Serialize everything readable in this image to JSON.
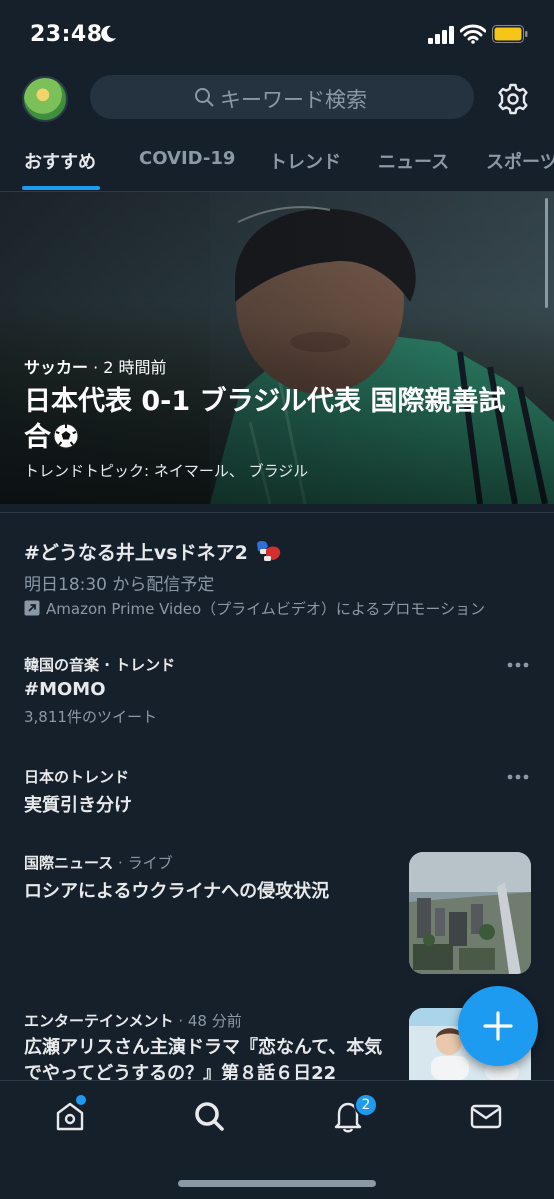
{
  "status_bar": {
    "time": "23:48"
  },
  "search": {
    "placeholder": "キーワード検索"
  },
  "tabs": [
    {
      "label": "おすすめ"
    },
    {
      "label": "COVID-19"
    },
    {
      "label": "トレンド"
    },
    {
      "label": "ニュース"
    },
    {
      "label": "スポーツ"
    }
  ],
  "hero": {
    "category": "サッカー",
    "time": "· 2 時間前",
    "title": "日本代表 0-1 ブラジル代表 国際親善試合",
    "emoji": "soccer-ball-icon",
    "topics": "トレンドトピック: ネイマール、 ブラジル"
  },
  "promo": {
    "title": "#どうなる井上vsドネア2",
    "emoji": "boxing-glove-icon",
    "subtitle": "明日18:30 から配信予定",
    "ad_text": "Amazon Prime Video（プライムビデオ）によるプロモーション"
  },
  "trends": [
    {
      "context": "韓国の音楽 · トレンド",
      "title": "#MOMO",
      "count": "3,811件のツイート"
    },
    {
      "context": "日本のトレンド",
      "title": "実質引き分け"
    }
  ],
  "news": [
    {
      "category": "国際ニュース",
      "meta": " · ライブ",
      "title": "ロシアによるウクライナへの侵攻状況"
    },
    {
      "category": "エンターテインメント",
      "meta": " · 48 分前",
      "title": "広瀬アリスさん主演ドラマ『恋なんて、本気でやってどうするの？』第８話６日22"
    }
  ],
  "bottom_nav": {
    "notifications_badge": "2"
  },
  "colors": {
    "background": "#15202b",
    "accent": "#1d9bf0",
    "text": "#e7e9ea",
    "muted": "#8b98a5"
  }
}
